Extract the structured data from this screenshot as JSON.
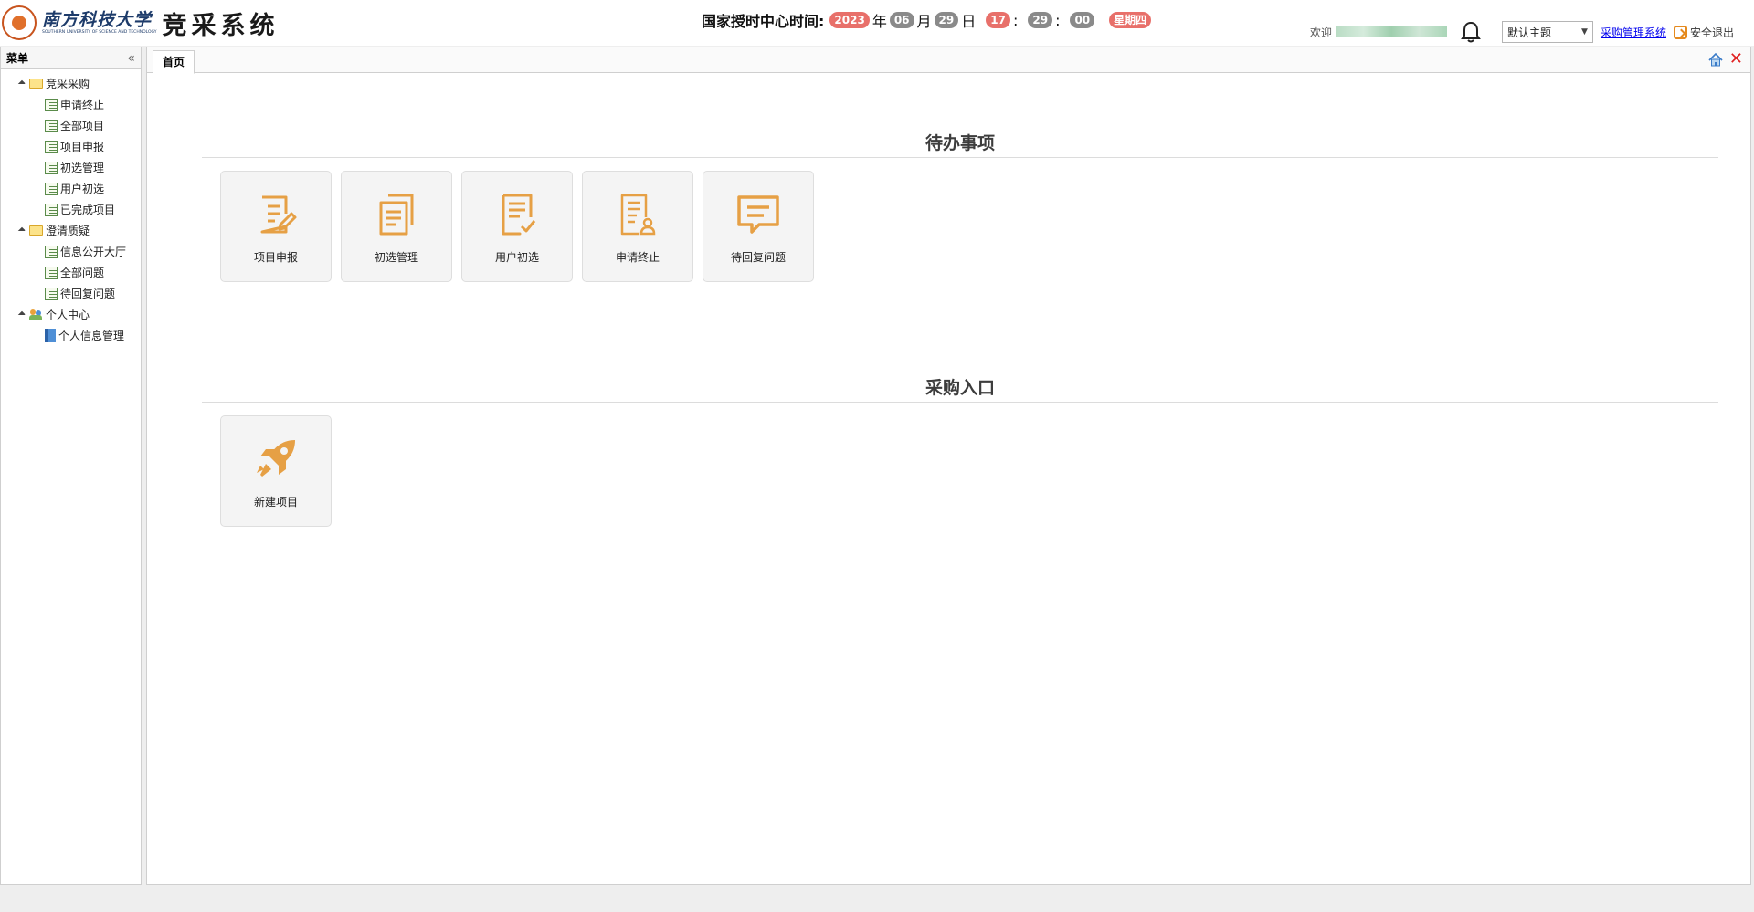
{
  "header": {
    "university_name": "南方科技大学",
    "university_en": "SOUTHERN UNIVERSITY OF SCIENCE AND TECHNOLOGY",
    "system_name": "竞采系统",
    "clock": {
      "label": "国家授时中心时间:",
      "year": "2023",
      "year_unit": "年",
      "month": "06",
      "month_unit": "月",
      "day": "29",
      "day_unit": "日",
      "hour": "17",
      "sep1": ":",
      "minute": "29",
      "sep2": ":",
      "second": "00",
      "weekday": "星期四"
    },
    "welcome": "欢迎",
    "theme_select": "默认主题",
    "procurement_link": "采购管理系统",
    "logout": "安全退出"
  },
  "sidebar": {
    "title": "菜单",
    "groups": [
      {
        "label": "竞采采购",
        "icon": "folder-icon",
        "items": [
          "申请终止",
          "全部项目",
          "项目申报",
          "初选管理",
          "用户初选",
          "已完成项目"
        ]
      },
      {
        "label": "澄清质疑",
        "icon": "folder-icon",
        "items": [
          "信息公开大厅",
          "全部问题",
          "待回复问题"
        ]
      },
      {
        "label": "个人中心",
        "icon": "users-icon",
        "items": [
          "个人信息管理"
        ]
      }
    ]
  },
  "tabs": {
    "home": "首页"
  },
  "todo": {
    "title": "待办事项",
    "cards": [
      "项目申报",
      "初选管理",
      "用户初选",
      "申请终止",
      "待回复问题"
    ]
  },
  "purchase": {
    "title": "采购入口",
    "cards": [
      "新建项目"
    ]
  },
  "colors": {
    "accent": "#e6a045",
    "clock_red": "#e8706a",
    "clock_gray": "#8a8a8a"
  }
}
